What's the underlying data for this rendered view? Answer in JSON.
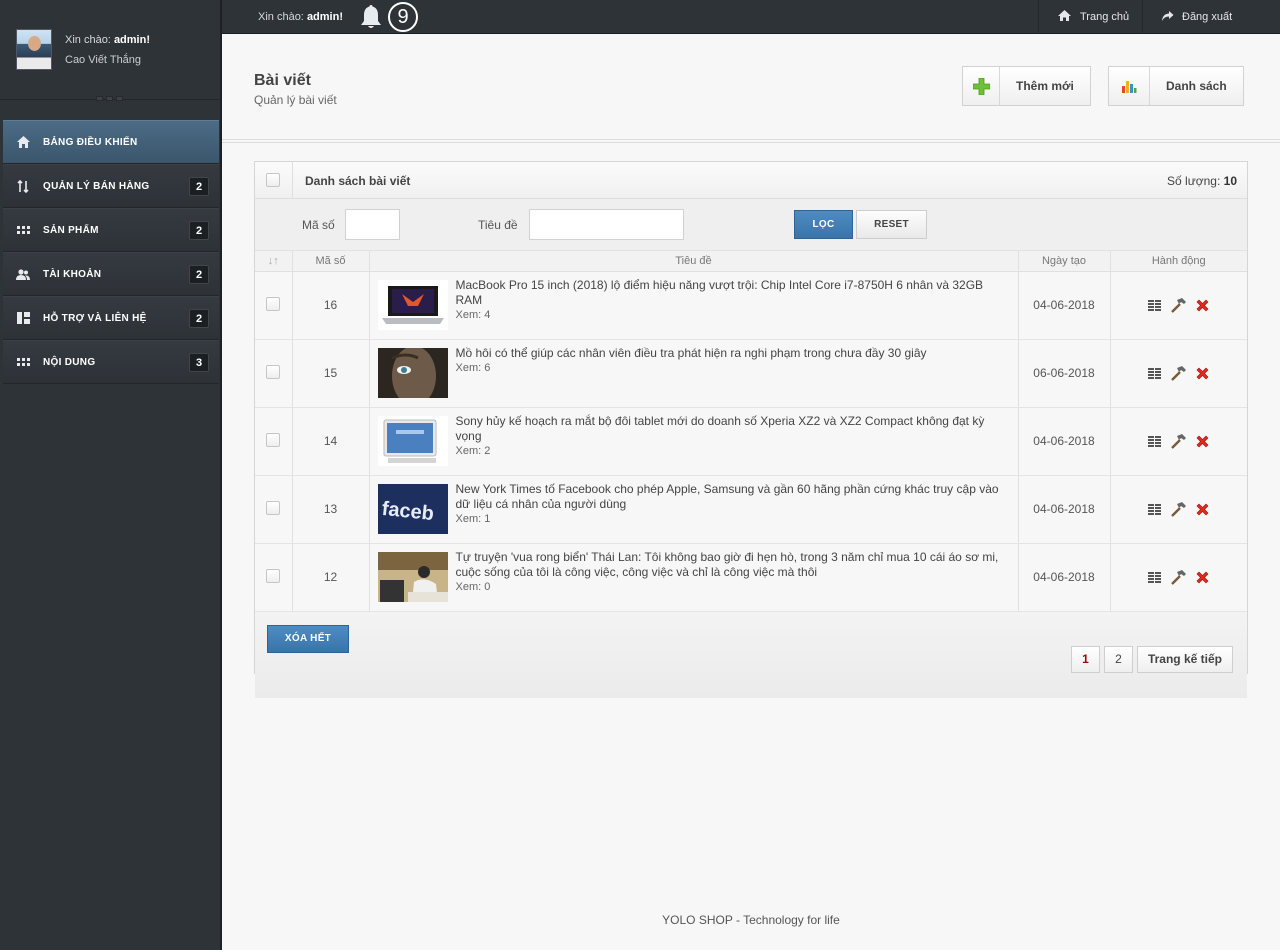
{
  "user": {
    "greeting_prefix": "Xin chào:",
    "username": "admin!",
    "full_name": "Cao Viết Thắng"
  },
  "notifications": {
    "count": "9"
  },
  "topbar": {
    "home_label": "Trang chủ",
    "logout_label": "Đăng xuất"
  },
  "sidebar": {
    "items": [
      {
        "label": "BẢNG ĐIỀU KHIỂN",
        "icon": "home-icon",
        "badge": null,
        "active": true
      },
      {
        "label": "QUẢN LÝ BÁN HÀNG",
        "icon": "sort-arrows-icon",
        "badge": "2"
      },
      {
        "label": "SẢN PHẨM",
        "icon": "grid-icon",
        "badge": "2"
      },
      {
        "label": "TÀI KHOẢN",
        "icon": "users-icon",
        "badge": "2"
      },
      {
        "label": "HỖ TRỢ VÀ LIÊN HỆ",
        "icon": "layout-icon",
        "badge": "2"
      },
      {
        "label": "NỘI DUNG",
        "icon": "grid-icon",
        "badge": "3"
      }
    ]
  },
  "page": {
    "title": "Bài viết",
    "subtitle": "Quản lý bài viết",
    "add_label": "Thêm mới",
    "list_label": "Danh sách"
  },
  "panel": {
    "title": "Danh sách bài viết",
    "count_label": "Số lượng:",
    "count_value": "10",
    "filter": {
      "id_label": "Mã số",
      "id_value": "",
      "title_label": "Tiêu đề",
      "title_value": "",
      "filter_button": "LỌC",
      "reset_button": "RESET"
    },
    "columns": {
      "sort": "↓↑",
      "id": "Mã số",
      "title": "Tiêu đề",
      "date": "Ngày tạo",
      "actions": "Hành động"
    },
    "rows": [
      {
        "id": "16",
        "title": "MacBook Pro 15 inch (2018) lộ điểm hiệu năng vượt trội: Chip Intel Core i7-8750H 6 nhân và 32GB RAM",
        "views": "Xem: 4",
        "date": "04-06-2018",
        "thumb": "laptop"
      },
      {
        "id": "15",
        "title": "Mồ hôi có thể giúp các nhân viên điều tra phát hiện ra nghi phạm trong chưa đầy 30 giây",
        "views": "Xem: 6",
        "date": "06-06-2018",
        "thumb": "face"
      },
      {
        "id": "14",
        "title": "Sony hủy kế hoạch ra mắt bộ đôi tablet mới do doanh số Xperia XZ2 và XZ2 Compact không đạt kỳ vọng",
        "views": "Xem: 2",
        "date": "04-06-2018",
        "thumb": "tablet"
      },
      {
        "id": "13",
        "title": "New York Times tố Facebook cho phép Apple, Samsung và gần 60 hãng phần cứng khác truy cập vào dữ liệu cá nhân của người dùng",
        "views": "Xem: 1",
        "date": "04-06-2018",
        "thumb": "facebook"
      },
      {
        "id": "12",
        "title": "Tự truyện 'vua rong biển' Thái Lan: Tôi không bao giờ đi hẹn hò, trong 3 năm chỉ mua 10 cái áo sơ mi, cuộc sống của tôi là công việc, công việc và chỉ là công việc mà thôi",
        "views": "Xem: 0",
        "date": "04-06-2018",
        "thumb": "office"
      }
    ],
    "delete_all": "XÓA HẾT",
    "pagination": {
      "pages": [
        "1",
        "2"
      ],
      "current": "1",
      "next": "Trang kế tiếp"
    }
  },
  "footer": "YOLO SHOP - Technology for life"
}
